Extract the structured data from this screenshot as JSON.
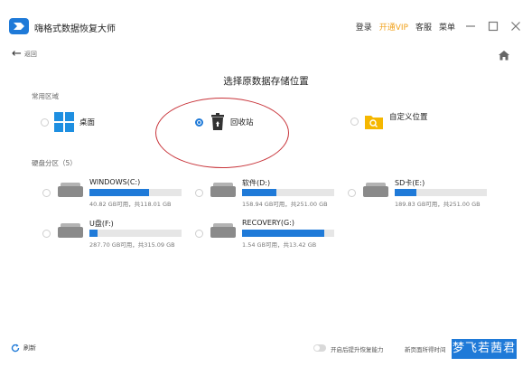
{
  "app": {
    "title": "嗨格式数据恢复大师"
  },
  "top_menu": {
    "login": "登录",
    "vip": "开通VIP",
    "service": "客服",
    "menu": "菜单"
  },
  "nav": {
    "back_label": "返回"
  },
  "main": {
    "title": "选择原数据存储位置",
    "common_area_label": "常用区域",
    "locations": [
      {
        "label": "桌面",
        "icon": "windows-icon",
        "selected": false
      },
      {
        "label": "回收站",
        "icon": "trash-icon",
        "selected": true
      },
      {
        "label": "自定义位置",
        "icon": "folder-icon",
        "selected": false
      }
    ],
    "partition_label": "硬盘分区（5）",
    "drives": [
      {
        "name": "WINDOWS(C:)",
        "free": "40.82 GB可用，共118.01 GB",
        "used_fraction": 0.65
      },
      {
        "name": "软件(D:)",
        "free": "158.94 GB可用，共251.00 GB",
        "used_fraction": 0.37
      },
      {
        "name": "SD卡(E:)",
        "free": "189.83 GB可用，共251.00 GB",
        "used_fraction": 0.24
      },
      {
        "name": "U盘(F:)",
        "free": "287.70 GB可用，共315.09 GB",
        "used_fraction": 0.09
      },
      {
        "name": "RECOVERY(G:)",
        "free": "1.54 GB可用，共13.42 GB",
        "used_fraction": 0.89
      }
    ]
  },
  "bottom": {
    "refresh_label": "刷新",
    "toggle_label": "开启后提升恢复能力",
    "sub_label": "新页面所得时间",
    "watermark": "梦飞若茜君"
  },
  "colors": {
    "accent": "#1f7ad8",
    "vip": "#f1a21c",
    "annotation_circle": "#c8343a"
  }
}
